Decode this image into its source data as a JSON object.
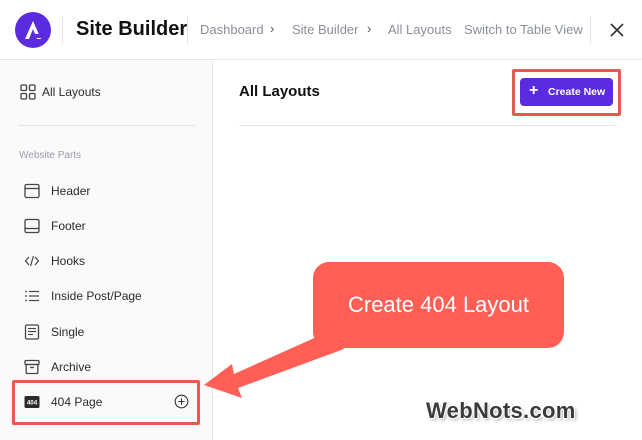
{
  "header": {
    "app_title": "Site Builder",
    "breadcrumbs": [
      "Dashboard",
      "Site Builder",
      "All Layouts"
    ],
    "switch_view": "Switch to Table View",
    "logo_icon": "astra-logo-icon",
    "close_icon": "close-icon"
  },
  "sidebar": {
    "all_layouts": "All Layouts",
    "section_label": "Website Parts",
    "items": [
      {
        "label": "Header",
        "icon": "header-layout-icon"
      },
      {
        "label": "Footer",
        "icon": "footer-layout-icon"
      },
      {
        "label": "Hooks",
        "icon": "code-icon"
      },
      {
        "label": "Inside Post/Page",
        "icon": "list-icon"
      },
      {
        "label": "Single",
        "icon": "single-page-icon"
      },
      {
        "label": "Archive",
        "icon": "archive-icon"
      },
      {
        "label": "404 Page",
        "icon": "404-icon",
        "badge": "404"
      }
    ]
  },
  "main": {
    "title": "All Layouts",
    "create_button": "Create New"
  },
  "annotation": {
    "callout": "Create 404 Layout",
    "watermark": "WebNots.com"
  },
  "colors": {
    "accent": "#5b2be0",
    "highlight": "#e45c4f",
    "callout": "#ff5f55"
  }
}
